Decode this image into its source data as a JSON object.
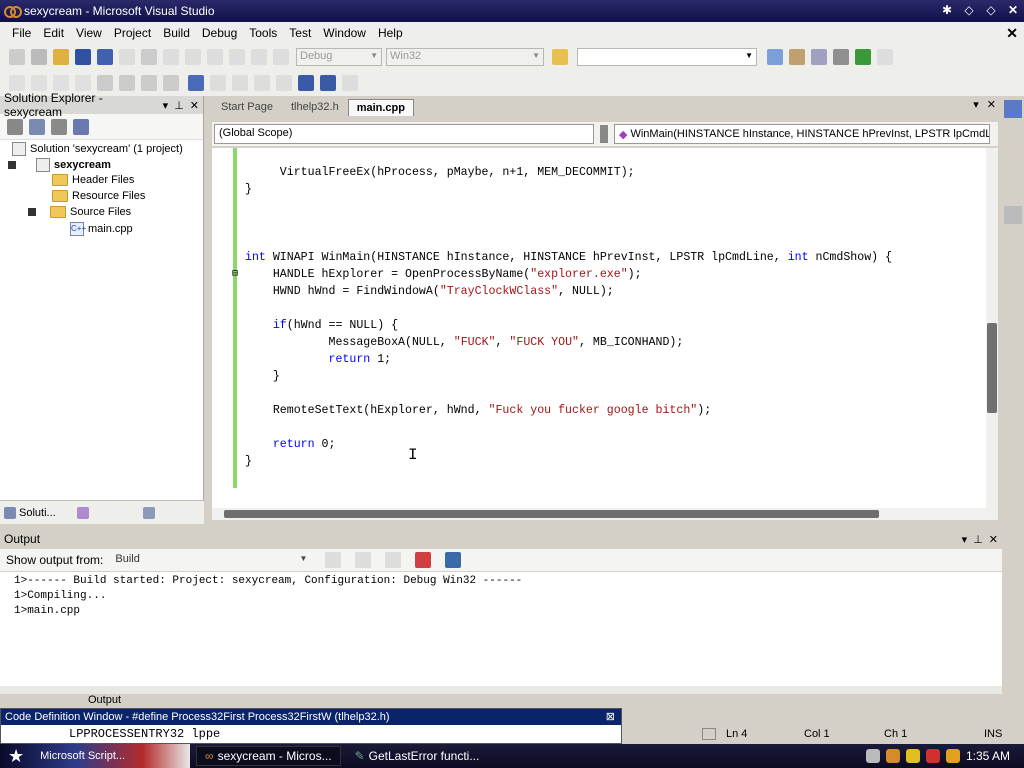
{
  "window": {
    "title": "sexycream - Microsoft Visual Studio"
  },
  "menu": [
    "File",
    "Edit",
    "View",
    "Project",
    "Build",
    "Debug",
    "Tools",
    "Test",
    "Window",
    "Help"
  ],
  "toolbar": {
    "config": "Debug",
    "platform": "Win32"
  },
  "solution_explorer": {
    "title": "Solution Explorer - sexycream",
    "solution": "Solution 'sexycream' (1 project)",
    "project": "sexycream",
    "items": [
      "Header Files",
      "Resource Files",
      "Source Files",
      "main.cpp"
    ],
    "tab_label": "Soluti..."
  },
  "editor": {
    "tabs": [
      "Start Page",
      "tlhelp32.h",
      "main.cpp"
    ],
    "scope_left": "(Global Scope)",
    "scope_right": "WinMain(HINSTANCE hInstance, HINSTANCE hPrevInst, LPSTR lpCmdLine,",
    "lines": [
      "     VirtualFreeEx(hProcess, pMaybe, n+1, MEM_DECOMMIT);",
      "}",
      "",
      "",
      "",
      "int WINAPI WinMain(HINSTANCE hInstance, HINSTANCE hPrevInst, LPSTR lpCmdLine, int nCmdShow) {",
      "    HANDLE hExplorer = OpenProcessByName(\"explorer.exe\");",
      "    HWND hWnd = FindWindowA(\"TrayClockWClass\", NULL);",
      "",
      "    if(hWnd == NULL) {",
      "            MessageBoxA(NULL, \"FUCK\", \"FUCK YOU\", MB_ICONHAND);",
      "            return 1;",
      "    }",
      "",
      "    RemoteSetText(hExplorer, hWnd, \"Fuck you fucker google bitch\");",
      "",
      "    return 0;",
      "}"
    ]
  },
  "output": {
    "title": "Output",
    "show_from_label": "Show output from:",
    "show_from_value": "Build",
    "lines": [
      "1>------ Build started: Project: sexycream, Configuration: Debug Win32 ------",
      "1>Compiling...",
      "1>main.cpp"
    ],
    "tab_label": "Output"
  },
  "code_definition": {
    "title": "Code Definition Window - #define Process32First Process32FirstW (tlhelp32.h)",
    "line": "LPPROCESSENTRY32 lppe"
  },
  "status": {
    "ln": "Ln 4",
    "col": "Col 1",
    "ch": "Ch 1",
    "mode": "INS"
  },
  "taskbar": {
    "start_label": "Microsoft Script...",
    "tasks": [
      "sexycream - Micros...",
      "GetLastError functi..."
    ],
    "clock": "1:35 AM"
  }
}
